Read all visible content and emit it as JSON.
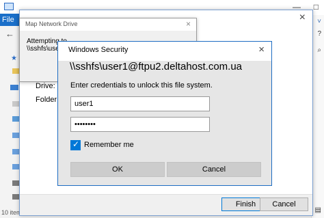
{
  "explorer": {
    "file_tab": "File",
    "status_text": "10 items"
  },
  "wizard": {
    "title": "Map Network Drive",
    "drive_label": "Drive:",
    "folder_label": "Folder:",
    "finish_label": "Finish",
    "cancel_label": "Cancel"
  },
  "progress": {
    "title": "Map Network Drive",
    "line1": "Attempting to connect to",
    "line2": "\\\\sshfs\\user1"
  },
  "security": {
    "title": "Windows Security",
    "heading": "\\\\sshfs\\user1@ftpu2.deltahost.com.ua",
    "description": "Enter credentials to unlock this file system.",
    "username_value": "user1",
    "password_value": "••••••••",
    "remember_label": "Remember me",
    "remember_checked": true,
    "ok_label": "OK",
    "cancel_label": "Cancel",
    "accent_color": "#0078d7"
  }
}
